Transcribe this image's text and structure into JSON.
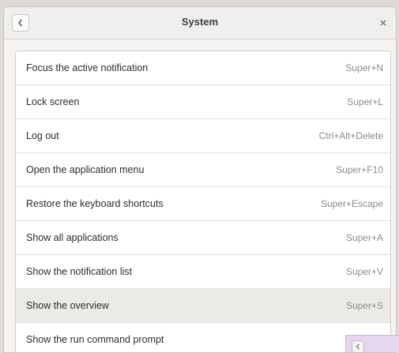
{
  "header": {
    "title": "System"
  },
  "icons": {
    "back": "chevron-left-icon",
    "close": "close-icon"
  },
  "shortcuts": [
    {
      "name": "Focus the active notification",
      "shortcut": "Super+N"
    },
    {
      "name": "Lock screen",
      "shortcut": "Super+L"
    },
    {
      "name": "Log out",
      "shortcut": "Ctrl+Alt+Delete"
    },
    {
      "name": "Open the application menu",
      "shortcut": "Super+F10"
    },
    {
      "name": "Restore the keyboard shortcuts",
      "shortcut": "Super+Escape"
    },
    {
      "name": "Show all applications",
      "shortcut": "Super+A"
    },
    {
      "name": "Show the notification list",
      "shortcut": "Super+V"
    },
    {
      "name": "Show the overview",
      "shortcut": "Super+S"
    },
    {
      "name": "Show the run command prompt",
      "shortcut": ""
    }
  ],
  "colors": {
    "window_bg": "#f4f3f2",
    "list_bg": "#ffffff",
    "highlight_row": "#eceae7",
    "popup_bg": "#e6d7ee"
  }
}
